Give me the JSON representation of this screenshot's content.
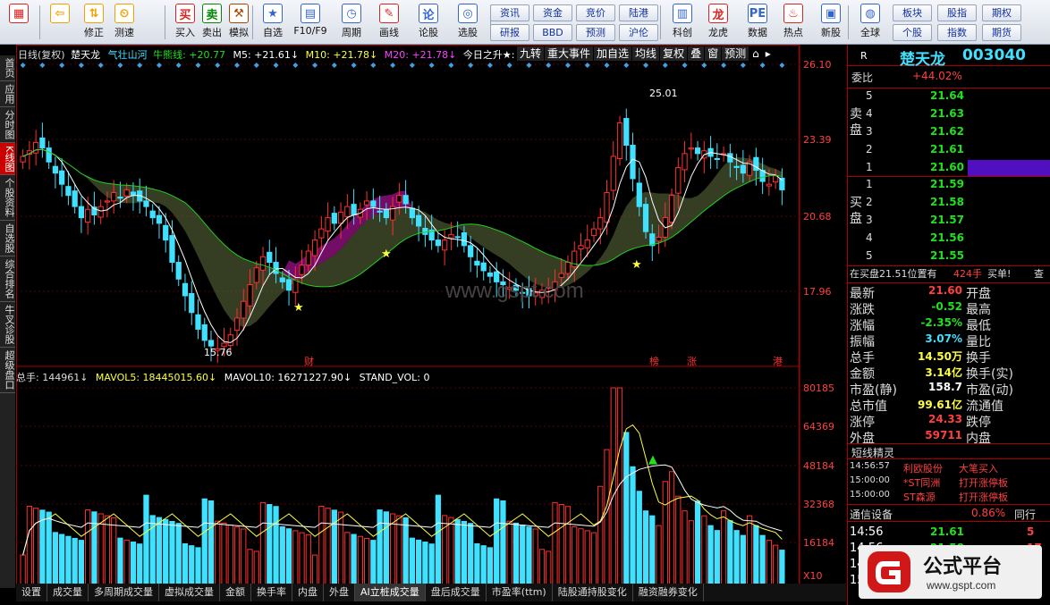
{
  "toolbar": {
    "buttons": [
      {
        "label": "",
        "icon": "grid-icon"
      },
      {
        "label": "",
        "icon": "back-arrow-icon"
      },
      {
        "label": "修正",
        "icon": "up-down-icon"
      },
      {
        "label": "测速",
        "icon": "clock-icon"
      },
      {
        "label": "买入",
        "icon": "buy-icon",
        "glyph": "买"
      },
      {
        "label": "卖出",
        "icon": "sell-icon",
        "glyph": "卖"
      },
      {
        "label": "模拟",
        "icon": "hammer-icon"
      },
      {
        "label": "自选",
        "icon": "star-icon"
      },
      {
        "label": "F10/F9",
        "icon": "f10-icon"
      },
      {
        "label": "周期",
        "icon": "period-icon"
      },
      {
        "label": "画线",
        "icon": "pencil-icon"
      },
      {
        "label": "论股",
        "icon": "chat-icon"
      },
      {
        "label": "选股",
        "icon": "select-icon"
      },
      {
        "label": "科创",
        "icon": "star-market-icon"
      },
      {
        "label": "龙虎",
        "icon": "dragon-icon"
      },
      {
        "label": "数据",
        "icon": "pe-icon"
      },
      {
        "label": "热点",
        "icon": "fire-icon"
      },
      {
        "label": "新股",
        "icon": "new-stock-icon"
      },
      {
        "label": "全球",
        "icon": "globe-icon"
      }
    ],
    "grid_buttons": [
      "资讯",
      "资金",
      "竞价",
      "陆港",
      "研报",
      "BBD",
      "预测",
      "沪伦",
      "板块",
      "股指",
      "期权",
      "个股",
      "指数",
      "期货"
    ]
  },
  "sidebar": {
    "tabs": [
      "首页",
      "应用",
      "分时图",
      "K线图",
      "个股资料",
      "自选股",
      "综合排名",
      "牛叉诊股",
      "超级盘口"
    ],
    "active": "K线图"
  },
  "chart": {
    "header": {
      "period": "日线(复权)",
      "stock": "楚天龙",
      "indicator1": "气壮山河",
      "indicator2": "牛熊线: +20.77",
      "ma5": "M5: +21.61↓",
      "ma10": "M10: +21.78↓",
      "ma20": "M20: +21.78↓",
      "extra": "今日之升★:"
    },
    "header_buttons": [
      "九转",
      "重大事件",
      "加自选",
      "均线",
      "复权",
      "叠",
      "窗",
      "预测"
    ],
    "price_axis": [
      "26.10",
      "23.39",
      "20.68",
      "17.96"
    ],
    "annotations": {
      "high": "25.01",
      "low": "15.76"
    },
    "markers": [
      "财",
      "榜",
      "涨",
      "港"
    ],
    "volume_header": {
      "total": "总手: 144961↓",
      "mavol5": "MAVOL5: 18445015.60↓",
      "mavol10": "MAVOL10: 16271227.90↓",
      "stand": "STAND_VOL: 0"
    },
    "volume_axis": [
      "80185",
      "64369",
      "48184",
      "32368",
      "16184",
      "X10"
    ],
    "watermark": "www.gspt.com"
  },
  "bottom_tabs": [
    "设置",
    "成交量",
    "多周期成交量",
    "虚拟成交量",
    "金额",
    "换手率",
    "内盘",
    "外盘",
    "AI立桩成交量",
    "盘后成交量",
    "市盈率(ttm)",
    "陆股通持股变化",
    "融资融券变化"
  ],
  "bottom_active": "AI立桩成交量",
  "quote": {
    "name": "楚天龙",
    "code": "003040",
    "weibi_label": "委比",
    "weibi": "+44.02%",
    "sell_label": "卖盘",
    "buy_label": "买盘",
    "sell": [
      {
        "lvl": "5",
        "price": "21.64"
      },
      {
        "lvl": "4",
        "price": "21.63"
      },
      {
        "lvl": "3",
        "price": "21.62"
      },
      {
        "lvl": "2",
        "price": "21.61"
      },
      {
        "lvl": "1",
        "price": "21.60"
      }
    ],
    "buy": [
      {
        "lvl": "1",
        "price": "21.59"
      },
      {
        "lvl": "2",
        "price": "21.58"
      },
      {
        "lvl": "3",
        "price": "21.57"
      },
      {
        "lvl": "4",
        "price": "21.56"
      },
      {
        "lvl": "5",
        "price": "21.55"
      }
    ],
    "order_note": "在买盘21.51位置有",
    "order_qty": "424手",
    "order_type": "买单!",
    "order_more": "查",
    "stats": [
      {
        "l1": "最新",
        "v1": "21.60",
        "c1": "red",
        "l2": "开盘"
      },
      {
        "l1": "涨跌",
        "v1": "-0.52",
        "c1": "grn",
        "l2": "最高"
      },
      {
        "l1": "涨幅",
        "v1": "-2.35%",
        "c1": "grn",
        "l2": "最低"
      },
      {
        "l1": "振幅",
        "v1": "3.07%",
        "c1": "cyan",
        "l2": "量比"
      },
      {
        "l1": "总手",
        "v1": "14.50万",
        "c1": "yel",
        "l2": "换手"
      },
      {
        "l1": "金额",
        "v1": "3.14亿",
        "c1": "yel",
        "l2": "换手(实)"
      },
      {
        "l1": "市盈(静)",
        "v1": "158.7",
        "c1": "wht",
        "l2": "市盈(动)"
      },
      {
        "l1": "总市值",
        "v1": "99.61亿",
        "c1": "yel",
        "l2": "流通值"
      },
      {
        "l1": "涨停",
        "v1": "24.33",
        "c1": "red",
        "l2": "跌停"
      },
      {
        "l1": "外盘",
        "v1": "59711",
        "c1": "red",
        "l2": "内盘"
      }
    ],
    "short_title": "短线精灵",
    "short": [
      {
        "time": "14:56:57",
        "name": "利欧股份",
        "event": "大笔买入"
      },
      {
        "time": "15:00:00",
        "name": "*ST同洲",
        "event": "打开涨停板"
      },
      {
        "time": "15:00:00",
        "name": "ST森源",
        "event": "打开涨停板"
      }
    ],
    "sector": "通信设备",
    "sector_pct": "0.86%",
    "sector_more": "同行",
    "ticks": [
      {
        "time": "14:56",
        "price": "21.61",
        "vol": "5"
      },
      {
        "time": "14:56",
        "price": "21.58",
        "vol": "17"
      },
      {
        "time": "14",
        "price": "",
        "vol": ""
      },
      {
        "time": "15",
        "price": "",
        "vol": ""
      }
    ]
  },
  "logo": {
    "text": "公式平台",
    "url": "www.gspt.com"
  }
}
